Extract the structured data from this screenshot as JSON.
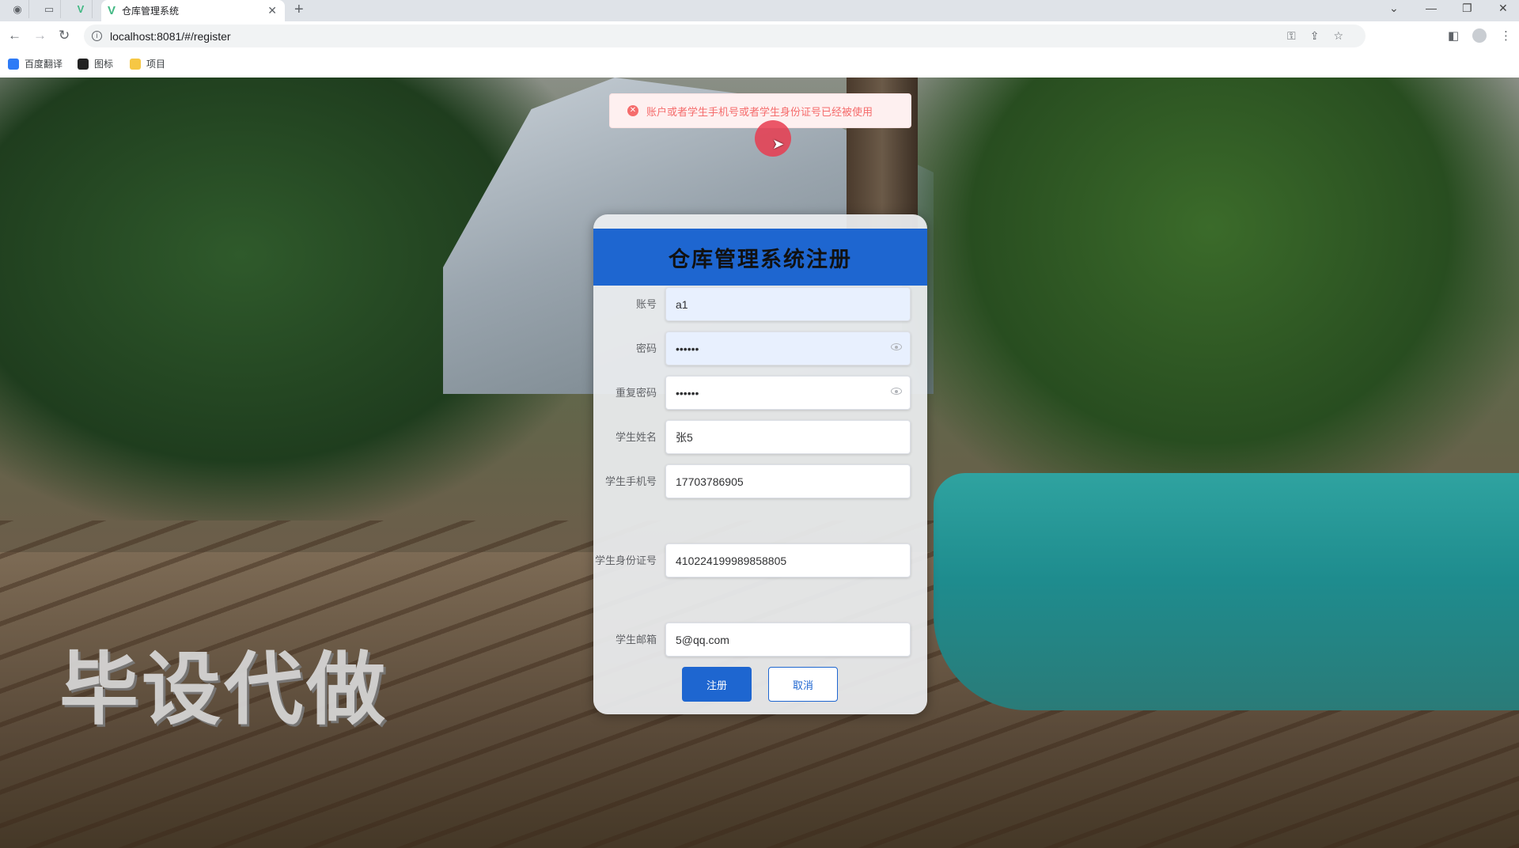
{
  "browser": {
    "tab_title": "仓库管理系统",
    "new_tab": "+",
    "url": "localhost:8081/#/register",
    "window_controls": [
      "⌄",
      "—",
      "❐",
      "✕"
    ],
    "bookmarks": [
      {
        "label": "百度翻译",
        "icon": "baidu-translate-icon",
        "color": "#2e7bf6"
      },
      {
        "label": "图标",
        "icon": "iconfont-icon",
        "color": "#222222"
      },
      {
        "label": "项目",
        "icon": "folder-icon",
        "color": "#f6c744"
      }
    ]
  },
  "message": {
    "type": "error",
    "text": "账户或者学生手机号或者学生身份证号已经被使用",
    "color": "#f56c6c"
  },
  "card": {
    "title": "仓库管理系统注册",
    "header_color": "#1e66d0",
    "fields": [
      {
        "label": "账号",
        "value": "a1"
      },
      {
        "label": "密码",
        "value": "••••••"
      },
      {
        "label": "重复密码",
        "value": "••••••"
      },
      {
        "label": "学生姓名",
        "value": "张5"
      },
      {
        "label": "学生手机号",
        "value": "17703786905"
      },
      {
        "label": "学生身份证号",
        "value": "410224199989858805"
      },
      {
        "label": "学生邮箱",
        "value": "5@qq.com"
      }
    ],
    "submit_label": "注册",
    "cancel_label": "取消"
  },
  "watermark": "毕设代做"
}
